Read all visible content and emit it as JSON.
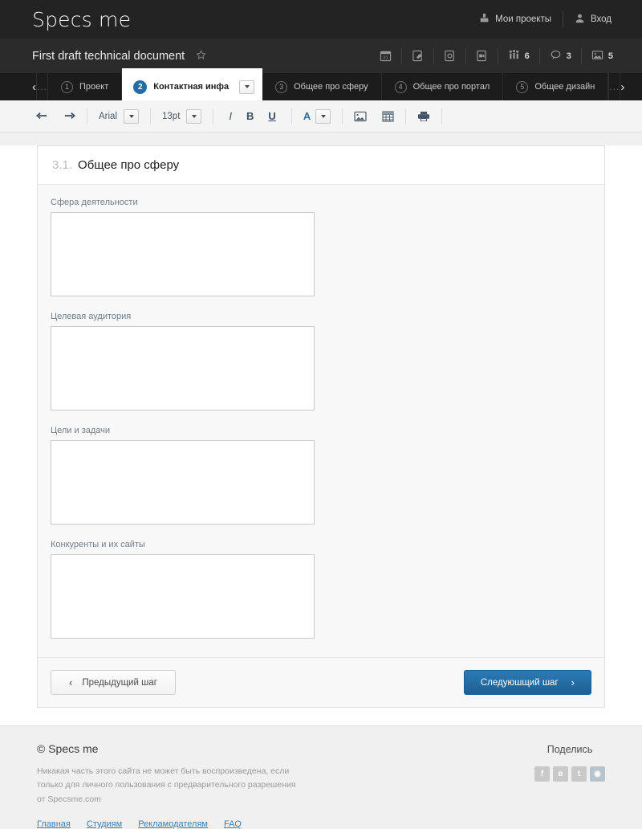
{
  "colors": {
    "topbar_bg": "#232323",
    "docbar_bg": "#2b2b2b",
    "tabsbar_bg": "#1c1c1c",
    "accent_blue": "#1f6ea8",
    "link_blue": "#3d7fb0",
    "footer_bg": "#f0f0f0"
  },
  "topbar": {
    "logo": "Specs me",
    "projects_label": "Мои проекты",
    "projects_icon": "projects-icon",
    "login_label": "Вход",
    "login_icon": "user-icon"
  },
  "docbar": {
    "title": "First draft technical document",
    "star_icon": "star-icon",
    "icons": [
      {
        "name": "calendar-icon",
        "count": ""
      },
      {
        "name": "edit-document-icon",
        "count": ""
      },
      {
        "name": "document-clock-icon",
        "count": ""
      },
      {
        "name": "document-video-icon",
        "count": ""
      },
      {
        "name": "people-icon",
        "count": "6"
      },
      {
        "name": "comment-icon",
        "count": "3"
      },
      {
        "name": "image-icon",
        "count": "5"
      }
    ]
  },
  "steps": {
    "prev_arrow": "‹",
    "next_arrow": "›",
    "ellipsis_left": "...",
    "ellipsis_right": "...",
    "tabs": [
      {
        "num": "1",
        "label": "Проект",
        "active": false
      },
      {
        "num": "2",
        "label": "Контактная инфа",
        "active": true
      },
      {
        "num": "3",
        "label": "Общее про сферу",
        "active": false
      },
      {
        "num": "4",
        "label": "Общее про портал",
        "active": false
      },
      {
        "num": "5",
        "label": "Общее дизайн",
        "active": false
      }
    ]
  },
  "toolbar": {
    "undo_icon": "undo-arrow-icon",
    "redo_icon": "redo-arrow-icon",
    "font_family": "Arial",
    "font_size": "13pt",
    "italic": "I",
    "bold": "B",
    "underline": "U",
    "text_color": "A",
    "image_icon": "insert-image-icon",
    "table_icon": "insert-table-icon",
    "print_icon": "print-icon"
  },
  "section": {
    "number": "3.1.",
    "title": "Общее про сферу",
    "fields": [
      {
        "label": "Сфера деятельности",
        "value": "",
        "placeholder": ""
      },
      {
        "label": "Целевая аудитория",
        "value": "",
        "placeholder": ""
      },
      {
        "label": "Цели и задачи",
        "value": "",
        "placeholder": ""
      },
      {
        "label": "Конкуренты и их сайты",
        "value": "",
        "placeholder": ""
      }
    ],
    "prev_button": "Предыдущий шаг",
    "next_button": "Следуюшщий шаг"
  },
  "footer": {
    "copyright": "© Specs me",
    "disclaimer": "Никакая часть этого сайта не может быть воспроизведена, если только для личного пользования с предварительного разрешения от Specsme.com",
    "links": [
      "Главная",
      "Студиям",
      "Рекламодателям",
      "FAQ"
    ],
    "share_title": "Поделись",
    "social": [
      {
        "name": "facebook-share-button",
        "glyph": "f"
      },
      {
        "name": "vk-share-button",
        "glyph": "в"
      },
      {
        "name": "twitter-share-button",
        "glyph": "t"
      },
      {
        "name": "other-share-button",
        "glyph": "◉"
      }
    ]
  }
}
